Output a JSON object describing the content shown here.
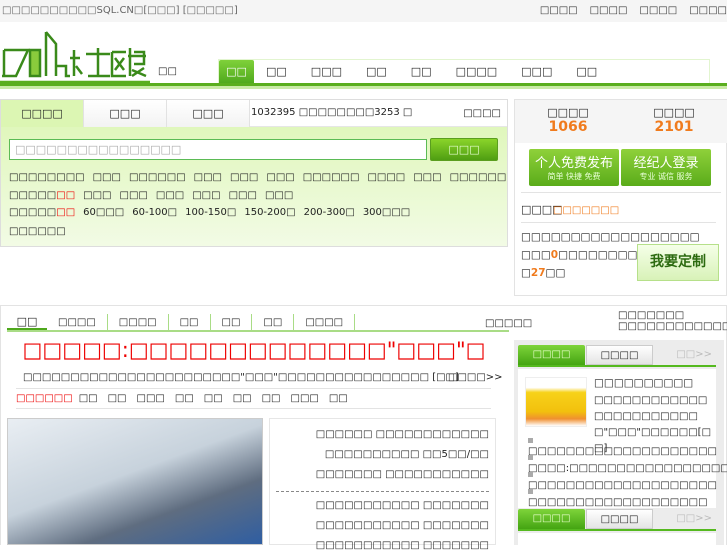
{
  "topbar": {
    "welcome": "□□□□□□□□□□SQL.CN□[□□□] [□□□□□]",
    "links": [
      "□□□□",
      "□□□□",
      "□□□□",
      "□□□□"
    ]
  },
  "header": {
    "logo_text": "SQL社区楼",
    "city": "□□",
    "nav": [
      "□□",
      "□□",
      "□□□",
      "□□",
      "□□",
      "□□□□",
      "□□□",
      "□□"
    ]
  },
  "search": {
    "tabs": [
      "□□□□",
      "□□□",
      "□□□"
    ],
    "stats": "1032395 □□□□□□□□3253 □",
    "stats_right": "□□□□",
    "placeholder": "□□□□□□□□□□□□□□□□",
    "button": "□□□",
    "rows": [
      {
        "label": "□□□□□□□□",
        "hot": "",
        "items": [
          "□□□",
          "□□□□□□",
          "□□□",
          "□□□",
          "□□□",
          "□□□□□□",
          "□□□□",
          "□□□",
          "□□□□□□"
        ]
      },
      {
        "label": "□□□□□",
        "hot": "□□",
        "items": [
          "□□□",
          "□□□",
          "□□□",
          "□□□",
          "□□□",
          "□□□"
        ]
      },
      {
        "label": "□□□□□",
        "hot": "□□",
        "items": [
          "60□□□",
          "60-100□",
          "100-150□",
          "150-200□",
          "200-300□",
          "300□□□"
        ]
      },
      {
        "label": "□□□□□□",
        "hot": "",
        "items": []
      }
    ]
  },
  "right_panel": {
    "stats": [
      {
        "label": "□□□□",
        "value": "1066"
      },
      {
        "label": "□□□□",
        "value": "2101"
      }
    ],
    "publish_button": {
      "title": "个人免费发布",
      "sub": "简单 快捷 免费"
    },
    "agent_button": {
      "title": "经纪人登录",
      "sub": "专业 诚信 服务"
    },
    "custom_title": "□□□□",
    "custom_link": "□□□□□□□",
    "custom_text1": "□□□□□□□□□□□□□□□□□□",
    "custom_text2a": "□□□",
    "custom_count1": "0",
    "custom_text2b": "□□□□□□□□□□□□",
    "custom_text3a": "□",
    "custom_count2": "27",
    "custom_text3b": "□□",
    "custom_button": "我要定制"
  },
  "main": {
    "tabs": [
      "□□",
      "□□□□",
      "□□□□",
      "□□",
      "□□",
      "□□",
      "□□□□"
    ],
    "tabs_right": "□□□□□",
    "top_right": "□□□□□□□ □□□□□□□□□□□□",
    "headline": "□□□□□:□□□□□□□□□□□□□\"□□□\"□",
    "summary": "□□□□□□□□□□□□□□□□□□□□□□□\"□□□\"□□□□□□□□□□□□□□□□ [□□]",
    "summary_more": "□□□□>>",
    "tag_label": "□□□□□□",
    "tags": [
      "□□",
      "□□",
      "□□□",
      "□□",
      "□□",
      "□□",
      "□□",
      "□□□",
      "□□"
    ],
    "news": [
      "□□□□□□ □□□□□□□□□□□□",
      "□□□□□□□□□□ □□5□□/□□",
      "□□□□□□□ □□□□□□□□□□□",
      "□□□□□□□□□□□ □□□□□□□",
      "□□□□□□□□□□□ □□□□□□□",
      "□□□□□□□□□□□ □□□□□□□"
    ]
  },
  "side": {
    "tabs1": [
      "□□□□",
      "□□□□"
    ],
    "more": "□□>>",
    "feature_title": "□□□□□□□□□□",
    "feature_text": "□□□□□□□□□□□□□□□□□□□□□□□□\"□□□\"□□□□□□[□□]",
    "list": [
      "□□□□□□□□□□□□□□□□□□□□",
      "□□□□:□□□□□□□□□□□□□□□□□",
      "□□□□□□□□□□□□□□□□□□□□",
      "□□□□□□□□□□□□□□□□□□□"
    ],
    "tabs2": [
      "□□□□",
      "□□□□"
    ]
  }
}
